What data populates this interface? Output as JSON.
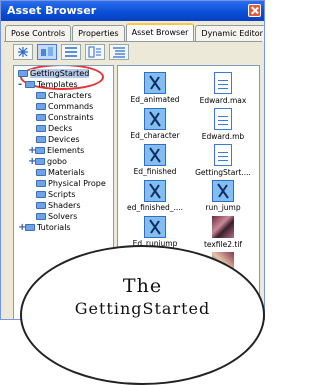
{
  "window": {
    "title": "Asset Browser"
  },
  "tabs": [
    {
      "label": "Pose Controls"
    },
    {
      "label": "Properties"
    },
    {
      "label": "Asset Browser"
    },
    {
      "label": "Dynamic Editor"
    }
  ],
  "toolbar": {
    "buttons": [
      "new-folder-icon",
      "assets-icon",
      "list-view-icon",
      "split-view-icon",
      "details-view-icon"
    ]
  },
  "tree": {
    "items": [
      {
        "label": "GettingStarted",
        "level": 0,
        "expander": ""
      },
      {
        "label": "Templates",
        "level": 0,
        "expander": "-"
      },
      {
        "label": "Characters",
        "level": 1
      },
      {
        "label": "Commands",
        "level": 1
      },
      {
        "label": "Constraints",
        "level": 1
      },
      {
        "label": "Decks",
        "level": 1
      },
      {
        "label": "Devices",
        "level": 1
      },
      {
        "label": "Elements",
        "level": 1,
        "expander": "+"
      },
      {
        "label": "gobo",
        "level": 1,
        "expander": "+"
      },
      {
        "label": "Materials",
        "level": 1
      },
      {
        "label": "Physical Prope",
        "level": 1
      },
      {
        "label": "Scripts",
        "level": 1
      },
      {
        "label": "Shaders",
        "level": 1
      },
      {
        "label": "Solvers",
        "level": 1
      },
      {
        "label": "Tutorials",
        "level": 0,
        "expander": "+"
      }
    ]
  },
  "files": [
    {
      "label": "Ed_animated",
      "icon": "animation-icon"
    },
    {
      "label": "Edward.max",
      "icon": "document-icon"
    },
    {
      "label": "Ed_character",
      "icon": "animation-icon"
    },
    {
      "label": "Edward.mb",
      "icon": "document-icon"
    },
    {
      "label": "Ed_finished",
      "icon": "animation-icon"
    },
    {
      "label": "GettingStart....",
      "icon": "document-icon"
    },
    {
      "label": "ed_finished_....",
      "icon": "animation-icon"
    },
    {
      "label": "run_jump",
      "icon": "animation-icon"
    },
    {
      "label": "Ed_runjump",
      "icon": "animation-icon"
    },
    {
      "label": "texfile2.tif",
      "icon": "texture-icon"
    },
    {
      "label": "",
      "icon": "animation-icon"
    },
    {
      "label": "",
      "icon": "texture-icon"
    }
  ],
  "caption": {
    "line1": "The",
    "line2": "GettingStarted"
  },
  "colors": {
    "titlebar": "#0a4fd6",
    "highlight": "#e53232",
    "selection": "#b7c9e9"
  }
}
